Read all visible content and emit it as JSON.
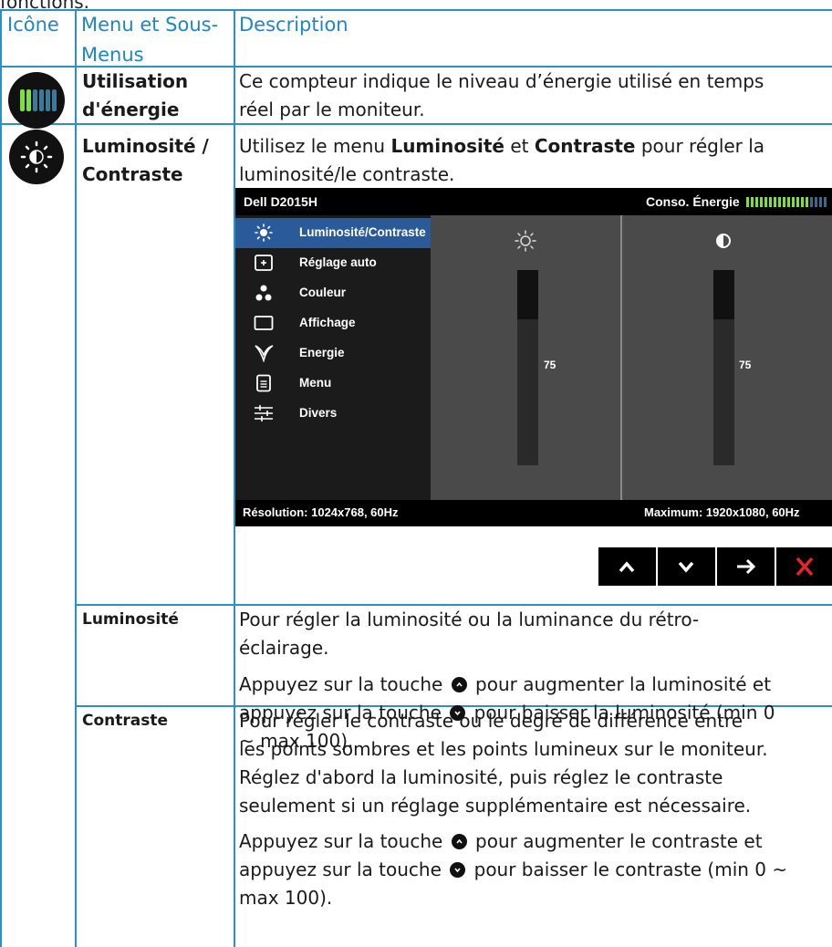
{
  "cut_off_text": "fonctions.",
  "header": {
    "col_icon": "Icône",
    "col_menu_line1": "Menu et Sous-",
    "col_menu_line2": "Menus",
    "col_desc": "Description"
  },
  "rows": {
    "energy": {
      "name_line1": "Utilisation",
      "name_line2": "d'énergie",
      "desc_line1": "Ce compteur indique le niveau d’énergie utilisé en temps",
      "desc_line2": "réel par le moniteur.",
      "icon": "energy-meter-icon"
    },
    "brightness_contrast": {
      "name_line1": "Luminosité /",
      "name_line2": "Contraste",
      "desc_pre": "Utilisez le menu ",
      "desc_b1": "Luminosité",
      "desc_mid": " et ",
      "desc_b2": "Contraste",
      "desc_post": " pour régler la",
      "desc_line2": "luminosité/le contraste.",
      "icon": "brightness-icon"
    },
    "brightness": {
      "name": "Luminosité",
      "p1_line1": "Pour régler la luminosité ou la luminance du rétro-",
      "p1_line2": "éclairage.",
      "p2_line1_pre": "Appuyez sur la touche ",
      "p2_line1_post": " pour augmenter la luminosité et",
      "p2_line2_pre": "appuyez sur la touche ",
      "p2_line2_post": " pour baisser la luminosité (min 0",
      "p2_line3": "~ max 100)."
    },
    "contrast": {
      "name": "Contraste",
      "p1_line1": "Pour régler le contraste ou le degré de différence entre",
      "p1_line2": "les points sombres et les points lumineux sur le moniteur.",
      "p1_line3": "Réglez d'abord la luminosité, puis réglez le contraste",
      "p1_line4": "seulement si un réglage supplémentaire est nécessaire.",
      "p2_line1_pre": "Appuyez sur la touche ",
      "p2_line1_post": " pour augmenter le contraste et",
      "p2_line2_pre": "appuyez sur la touche ",
      "p2_line2_post": " pour baisser le contraste (min 0 ~",
      "p2_line3": "max 100)."
    }
  },
  "osd": {
    "model": "Dell D2015H",
    "energy_label": "Conso. Énergie",
    "energy_level": 0.75,
    "menu_items": [
      {
        "label": "Luminosité/Contraste",
        "icon": "brightness-icon",
        "selected": true
      },
      {
        "label": "Réglage auto",
        "icon": "auto-adjust-icon",
        "selected": false
      },
      {
        "label": "Couleur",
        "icon": "color-icon",
        "selected": false
      },
      {
        "label": "Affichage",
        "icon": "display-icon",
        "selected": false
      },
      {
        "label": "Energie",
        "icon": "energy-leaf-icon",
        "selected": false
      },
      {
        "label": "Menu",
        "icon": "menu-icon",
        "selected": false
      },
      {
        "label": "Divers",
        "icon": "others-icon",
        "selected": false
      }
    ],
    "brightness_value": "75",
    "contrast_value": "75",
    "brightness_level": 0.75,
    "contrast_level": 0.75,
    "resolution": "Résolution: 1024x768, 60Hz",
    "maximum": "Maximum: 1920x1080, 60Hz",
    "nav_buttons": [
      "up-arrow-icon",
      "down-arrow-icon",
      "right-arrow-icon",
      "close-icon"
    ],
    "close_color": "#e8242a"
  },
  "colors": {
    "accent": "#1f86c4",
    "grid": "#2b8fc8",
    "osd_selected": "#2a5a9a"
  }
}
